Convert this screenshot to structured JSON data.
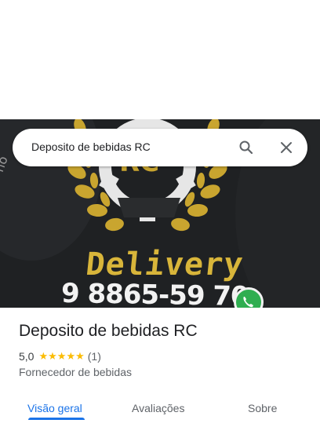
{
  "search": {
    "query": "Deposito de bebidas RC"
  },
  "hero": {
    "delivery_text": "Delivery",
    "phone_text": "9 8865-59 70"
  },
  "place": {
    "name": "Deposito de bebidas RC",
    "rating": "5,0",
    "stars": [
      "★",
      "★",
      "★",
      "★",
      "★"
    ],
    "review_count": "(1)",
    "category": "Fornecedor de bebidas"
  },
  "tabs": [
    {
      "label": "Visão geral",
      "active": true
    },
    {
      "label": "Avaliações",
      "active": false
    },
    {
      "label": "Sobre",
      "active": false
    }
  ],
  "colors": {
    "accent": "#1a73e8",
    "star": "#fbbc04",
    "logo_gold": "#d8b53a"
  }
}
